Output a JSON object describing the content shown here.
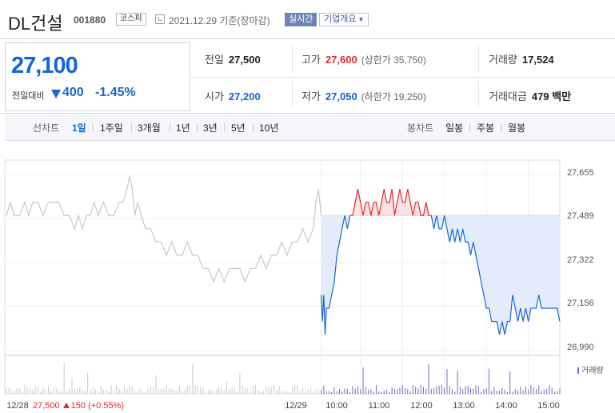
{
  "header": {
    "company_name": "DL건설",
    "code": "001880",
    "market": "코스피",
    "date": "2021.12.29",
    "basis": "기준(장마감)",
    "realtime_label": "실시간",
    "company_info_label": "기업개요"
  },
  "summary": {
    "current_price": "27,100",
    "change_label": "전일대비",
    "change_value": "400",
    "change_pct": "-1.45%",
    "prev_close_label": "전일",
    "prev_close": "27,500",
    "high_label": "고가",
    "high": "27,600",
    "upper_limit": "(상한가 35,750)",
    "volume_label": "거래량",
    "volume": "17,524",
    "open_label": "시가",
    "open": "27,200",
    "low_label": "저가",
    "low": "27,050",
    "lower_limit": "(하한가 19,250)",
    "amount_label": "거래대금",
    "amount": "479 백만"
  },
  "tabs": {
    "line_label": "선차트",
    "line": [
      "1일",
      "1주일",
      "3개월",
      "1년",
      "3년",
      "5년",
      "10년"
    ],
    "candle_label": "봉차트",
    "candle": [
      "일봉",
      "주봉",
      "월봉"
    ]
  },
  "colors": {
    "up": "#e52a2a",
    "down": "#1765d3",
    "prev_line": "#c8c8c8",
    "volume": "#7a66c2"
  },
  "chart_data": {
    "type": "line",
    "y_ticks": [
      "27,655",
      "27,489",
      "27,322",
      "27,156",
      "26,990"
    ],
    "ylim": [
      26990,
      27655
    ],
    "baseline": 27500,
    "x_labels": [
      "12/28",
      "12/29",
      "10:00",
      "11:00",
      "12:00",
      "13:00",
      "14:00",
      "15:00"
    ],
    "prev_day_summary": {
      "close": "27,500",
      "change": "150",
      "pct": "(+0.55%)"
    },
    "volume_legend": "거래량",
    "prev_day_series": [
      [
        0,
        27500
      ],
      [
        3,
        27550
      ],
      [
        6,
        27500
      ],
      [
        10,
        27500
      ],
      [
        14,
        27550
      ],
      [
        17,
        27500
      ],
      [
        20,
        27550
      ],
      [
        24,
        27550
      ],
      [
        28,
        27500
      ],
      [
        32,
        27550
      ],
      [
        36,
        27550
      ],
      [
        40,
        27550
      ],
      [
        44,
        27500
      ],
      [
        48,
        27500
      ],
      [
        52,
        27450
      ],
      [
        55,
        27500
      ],
      [
        58,
        27450
      ],
      [
        61,
        27500
      ],
      [
        64,
        27500
      ],
      [
        67,
        27550
      ],
      [
        70,
        27500
      ],
      [
        74,
        27550
      ],
      [
        78,
        27500
      ],
      [
        82,
        27500
      ],
      [
        86,
        27550
      ],
      [
        89,
        27550
      ],
      [
        92,
        27600
      ],
      [
        94,
        27650
      ],
      [
        96,
        27600
      ],
      [
        98,
        27500
      ],
      [
        100,
        27550
      ],
      [
        103,
        27500
      ],
      [
        106,
        27450
      ],
      [
        110,
        27450
      ],
      [
        114,
        27400
      ],
      [
        118,
        27400
      ],
      [
        122,
        27350
      ],
      [
        126,
        27400
      ],
      [
        130,
        27350
      ],
      [
        134,
        27350
      ],
      [
        138,
        27400
      ],
      [
        142,
        27350
      ],
      [
        146,
        27350
      ],
      [
        150,
        27300
      ],
      [
        154,
        27300
      ],
      [
        158,
        27250
      ],
      [
        162,
        27300
      ],
      [
        166,
        27250
      ],
      [
        170,
        27300
      ],
      [
        174,
        27300
      ],
      [
        178,
        27300
      ],
      [
        182,
        27250
      ],
      [
        186,
        27300
      ],
      [
        190,
        27300
      ],
      [
        194,
        27350
      ],
      [
        198,
        27300
      ],
      [
        202,
        27350
      ],
      [
        206,
        27350
      ],
      [
        210,
        27400
      ],
      [
        214,
        27350
      ],
      [
        218,
        27400
      ],
      [
        222,
        27400
      ],
      [
        226,
        27450
      ],
      [
        230,
        27400
      ],
      [
        234,
        27450
      ],
      [
        236,
        27550
      ],
      [
        238,
        27600
      ],
      [
        240,
        27500
      ]
    ],
    "today_series": [
      [
        240,
        27200
      ],
      [
        241,
        27100
      ],
      [
        242,
        27200
      ],
      [
        243,
        27050
      ],
      [
        244,
        27150
      ],
      [
        246,
        27150
      ],
      [
        248,
        27200
      ],
      [
        250,
        27250
      ],
      [
        252,
        27350
      ],
      [
        254,
        27400
      ],
      [
        256,
        27450
      ],
      [
        258,
        27500
      ],
      [
        260,
        27450
      ],
      [
        262,
        27500
      ],
      [
        264,
        27500
      ],
      [
        266,
        27550
      ],
      [
        268,
        27600
      ],
      [
        270,
        27550
      ],
      [
        272,
        27500
      ],
      [
        274,
        27550
      ],
      [
        276,
        27550
      ],
      [
        278,
        27500
      ],
      [
        280,
        27550
      ],
      [
        282,
        27550
      ],
      [
        284,
        27500
      ],
      [
        286,
        27550
      ],
      [
        288,
        27600
      ],
      [
        290,
        27550
      ],
      [
        292,
        27550
      ],
      [
        294,
        27600
      ],
      [
        296,
        27500
      ],
      [
        298,
        27550
      ],
      [
        300,
        27600
      ],
      [
        302,
        27550
      ],
      [
        304,
        27550
      ],
      [
        306,
        27600
      ],
      [
        308,
        27550
      ],
      [
        310,
        27500
      ],
      [
        312,
        27550
      ],
      [
        314,
        27550
      ],
      [
        316,
        27500
      ],
      [
        318,
        27500
      ],
      [
        320,
        27550
      ],
      [
        322,
        27500
      ],
      [
        324,
        27500
      ],
      [
        326,
        27450
      ],
      [
        328,
        27500
      ],
      [
        330,
        27450
      ],
      [
        332,
        27450
      ],
      [
        334,
        27500
      ],
      [
        336,
        27450
      ],
      [
        338,
        27400
      ],
      [
        340,
        27450
      ],
      [
        342,
        27400
      ],
      [
        344,
        27450
      ],
      [
        346,
        27400
      ],
      [
        348,
        27450
      ],
      [
        350,
        27400
      ],
      [
        352,
        27400
      ],
      [
        354,
        27350
      ],
      [
        356,
        27400
      ],
      [
        358,
        27350
      ],
      [
        360,
        27300
      ],
      [
        362,
        27250
      ],
      [
        364,
        27200
      ],
      [
        366,
        27150
      ],
      [
        368,
        27150
      ],
      [
        370,
        27100
      ],
      [
        372,
        27100
      ],
      [
        374,
        27100
      ],
      [
        376,
        27050
      ],
      [
        378,
        27100
      ],
      [
        380,
        27050
      ],
      [
        382,
        27100
      ],
      [
        384,
        27100
      ],
      [
        386,
        27200
      ],
      [
        388,
        27150
      ],
      [
        390,
        27100
      ],
      [
        392,
        27150
      ],
      [
        394,
        27100
      ],
      [
        396,
        27150
      ],
      [
        398,
        27100
      ],
      [
        400,
        27150
      ],
      [
        402,
        27150
      ],
      [
        404,
        27150
      ],
      [
        406,
        27200
      ],
      [
        408,
        27150
      ],
      [
        410,
        27150
      ],
      [
        412,
        27150
      ],
      [
        414,
        27150
      ],
      [
        416,
        27150
      ],
      [
        418,
        27150
      ],
      [
        420,
        27150
      ],
      [
        422,
        27100
      ]
    ]
  }
}
